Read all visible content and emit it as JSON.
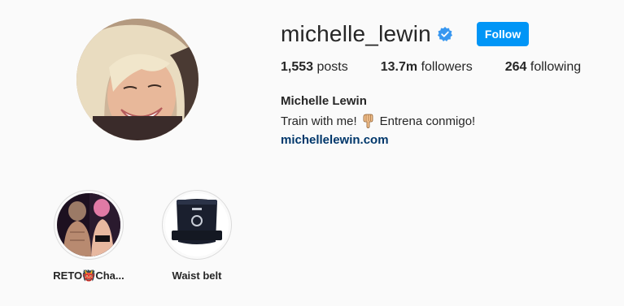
{
  "profile": {
    "username": "michelle_lewin",
    "follow_label": "Follow",
    "full_name": "Michelle Lewin",
    "bio_part1": "Train with me!",
    "bio_part2": "Entrena conmigo!",
    "link": "michellelewin.com"
  },
  "stats": {
    "posts_count": "1,553",
    "posts_label": "posts",
    "followers_count": "13.7m",
    "followers_label": "followers",
    "following_count": "264",
    "following_label": "following"
  },
  "highlights": [
    {
      "label": "RETO👹Cha..."
    },
    {
      "label": "Waist belt"
    }
  ],
  "colors": {
    "accent": "#0095f6",
    "link": "#00376b",
    "verified": "#3897f0",
    "background": "#fafafa"
  },
  "icons": {
    "verified": "verified-badge-icon",
    "bio_emoji": "pointing-down-hand-icon"
  }
}
